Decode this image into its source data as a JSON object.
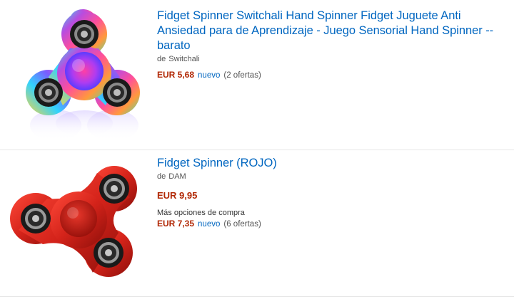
{
  "results": [
    {
      "title": "Fidget Spinner Switchali Hand Spinner Fidget Juguete Anti Ansiedad para de Aprendizaje - Juego Sensorial Hand Spinner -- barato",
      "brand_prefix": "de",
      "brand": "Switchali",
      "price": "EUR 5,68",
      "condition": "nuevo",
      "offers": "(2 ofertas)",
      "image_icon": "multicolor-fidget-spinner-image",
      "colors": {
        "body": "rainbow",
        "bearing": "#1a1a1a"
      }
    },
    {
      "title": "Fidget Spinner (ROJO)",
      "brand_prefix": "de",
      "brand": "DAM",
      "price": "EUR 9,95",
      "more_options": "Más opciones de compra",
      "alt_price": "EUR 7,35",
      "condition": "nuevo",
      "offers": "(6 ofertas)",
      "image_icon": "red-fidget-spinner-image",
      "colors": {
        "body": "#d4231a",
        "bearing": "#1a1a1a"
      }
    }
  ],
  "colors": {
    "link": "#0066c0",
    "price": "#b12704",
    "muted": "#555555",
    "divider": "#e7e7e7"
  }
}
